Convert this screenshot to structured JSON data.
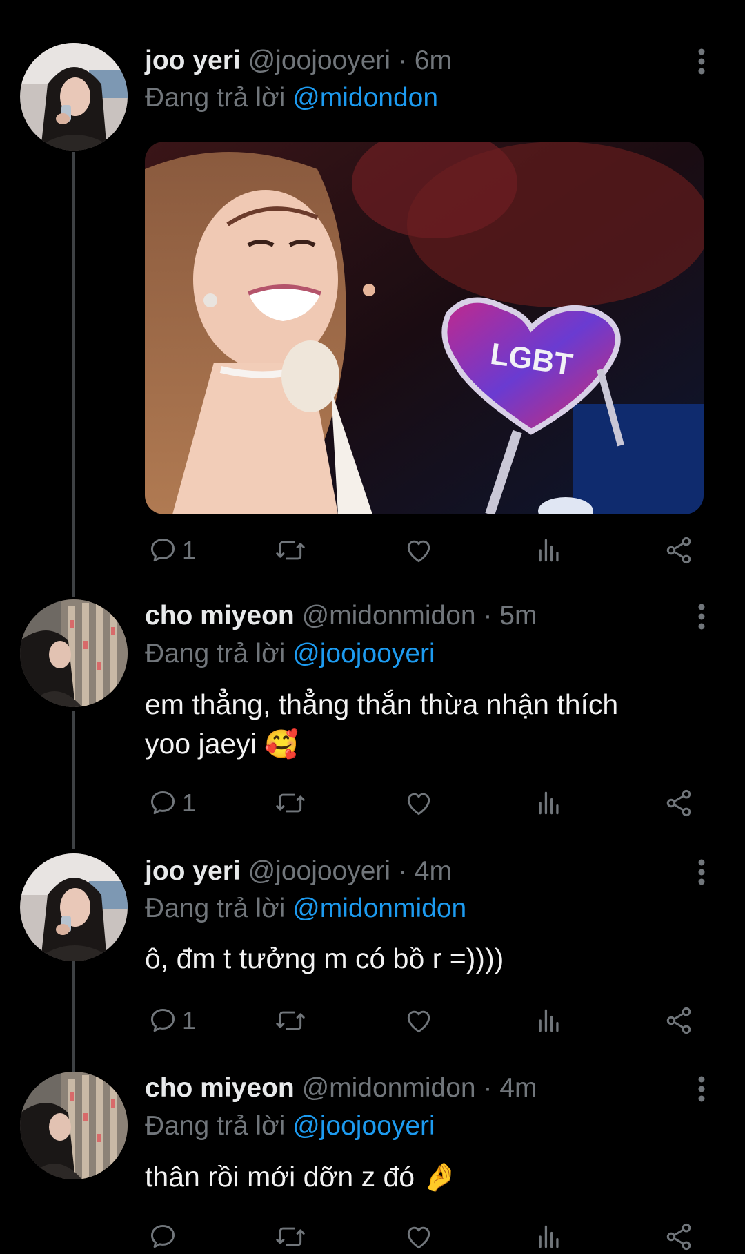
{
  "reply_prefix": "Đang trả lời",
  "tweets": [
    {
      "name": "joo yeri",
      "handle": "@joojooyeri",
      "separator": "·",
      "time": "6m",
      "reply_to": "@midondon",
      "text": "",
      "media": {
        "caption": "LGBT"
      },
      "reply_count": "1"
    },
    {
      "name": "cho miyeon",
      "handle": "@midonmidon",
      "separator": "·",
      "time": "5m",
      "reply_to": "@joojooyeri",
      "text_line1": "em thẳng, thẳng thắn thừa nhận thích",
      "text_line2": "yoo jaeyi ",
      "emoji": "🥰",
      "reply_count": "1"
    },
    {
      "name": "joo yeri",
      "handle": "@joojooyeri",
      "separator": "·",
      "time": "4m",
      "reply_to": "@midonmidon",
      "text_line1": "ô, đm t tưởng m có bồ r =))))",
      "reply_count": "1"
    },
    {
      "name": "cho miyeon",
      "handle": "@midonmidon",
      "separator": "·",
      "time": "4m",
      "reply_to": "@joojooyeri",
      "text_line1": "thân rồi mới dỡn z đó ",
      "emoji": "🤌",
      "reply_count": ""
    }
  ],
  "colors": {
    "background": "#000000",
    "primary_text": "#e7e9ea",
    "secondary_text": "#71767b",
    "link": "#1d9bf0",
    "thread_line": "#3e4144"
  },
  "icons": [
    "reply-icon",
    "retweet-icon",
    "like-icon",
    "views-icon",
    "share-icon",
    "more-icon"
  ]
}
